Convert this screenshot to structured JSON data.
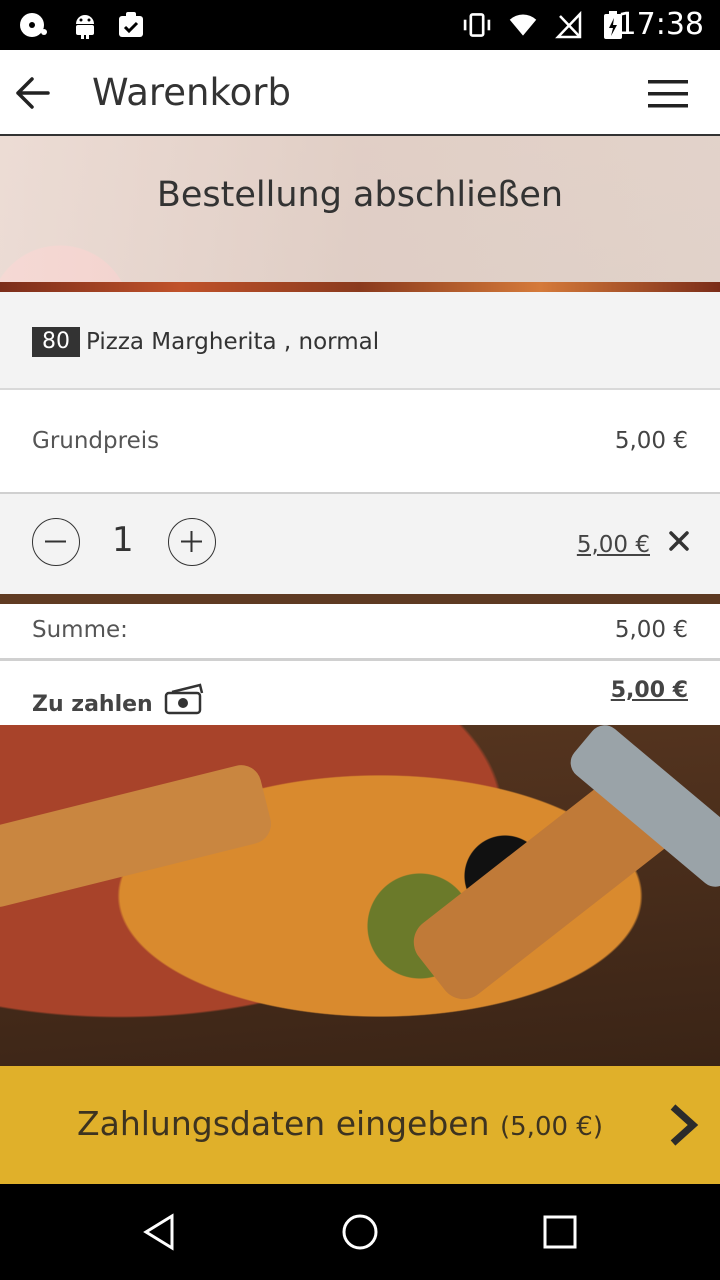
{
  "status_bar": {
    "time": "17:38"
  },
  "app_bar": {
    "title": "Warenkorb"
  },
  "hero": {
    "title": "Bestellung abschließen"
  },
  "cart_item": {
    "number": "80",
    "name": "Pizza Margherita , normal"
  },
  "base_price": {
    "label": "Grundpreis",
    "value": "5,00 €"
  },
  "quantity": {
    "value": "1",
    "line_total": "5,00 €"
  },
  "summary": {
    "sum_label": "Summe:",
    "sum_value": "5,00 €"
  },
  "payment": {
    "label": "Zu zahlen",
    "value": "5,00 €"
  },
  "cta": {
    "label": "Zahlungsdaten eingeben",
    "amount": "(5,00 €)"
  },
  "colors": {
    "accent": "#e0b02a",
    "text": "#333333"
  }
}
